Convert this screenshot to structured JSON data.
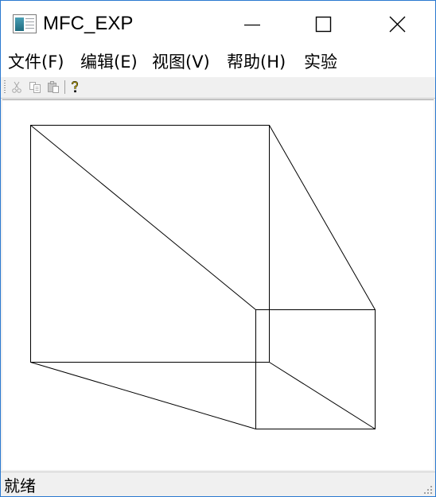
{
  "window": {
    "title": "MFC_EXP",
    "controls": {
      "minimize_icon": "minimize-icon",
      "maximize_icon": "maximize-icon",
      "close_icon": "close-icon"
    }
  },
  "menubar": {
    "items": [
      {
        "label": "文件(F)"
      },
      {
        "label": "编辑(E)"
      },
      {
        "label": "视图(V)"
      },
      {
        "label": "帮助(H)"
      },
      {
        "label": "实验"
      }
    ]
  },
  "toolbar": {
    "buttons": [
      {
        "icon": "cut-icon",
        "enabled": false
      },
      {
        "icon": "copy-icon",
        "enabled": false
      },
      {
        "icon": "paste-icon",
        "enabled": false
      },
      {
        "icon": "help-icon",
        "enabled": true
      }
    ]
  },
  "canvas": {
    "drawing": "wireframe-perspective-box",
    "stroke_color": "#000000",
    "background": "#ffffff"
  },
  "statusbar": {
    "text": "就绪"
  }
}
